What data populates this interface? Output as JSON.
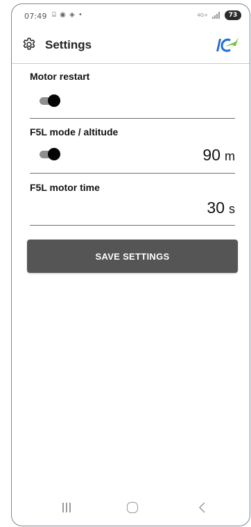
{
  "status_bar": {
    "time": "07:49",
    "notification_icons": "⌸ ◉ ◈ •",
    "network_label": "4G+",
    "battery": "73"
  },
  "app_bar": {
    "title": "Settings",
    "icon": "gear-icon",
    "logo": "ic-logo"
  },
  "settings": {
    "motor_restart": {
      "label": "Motor restart",
      "enabled": true
    },
    "f5l_mode": {
      "label": "F5L mode / altitude",
      "enabled": true,
      "value": "90",
      "unit": "m"
    },
    "f5l_motor_time": {
      "label": "F5L motor time",
      "value": "30",
      "unit": "s"
    }
  },
  "save_button": {
    "label": "SAVE SETTINGS"
  },
  "nav_bar": {
    "buttons": [
      "recent-apps",
      "home",
      "back"
    ]
  },
  "colors": {
    "button_bg": "#555555",
    "toggle_track": "#8f8f8f",
    "toggle_thumb": "#050505",
    "logo_blue": "#1f6fd1",
    "logo_green": "#7ac143"
  }
}
